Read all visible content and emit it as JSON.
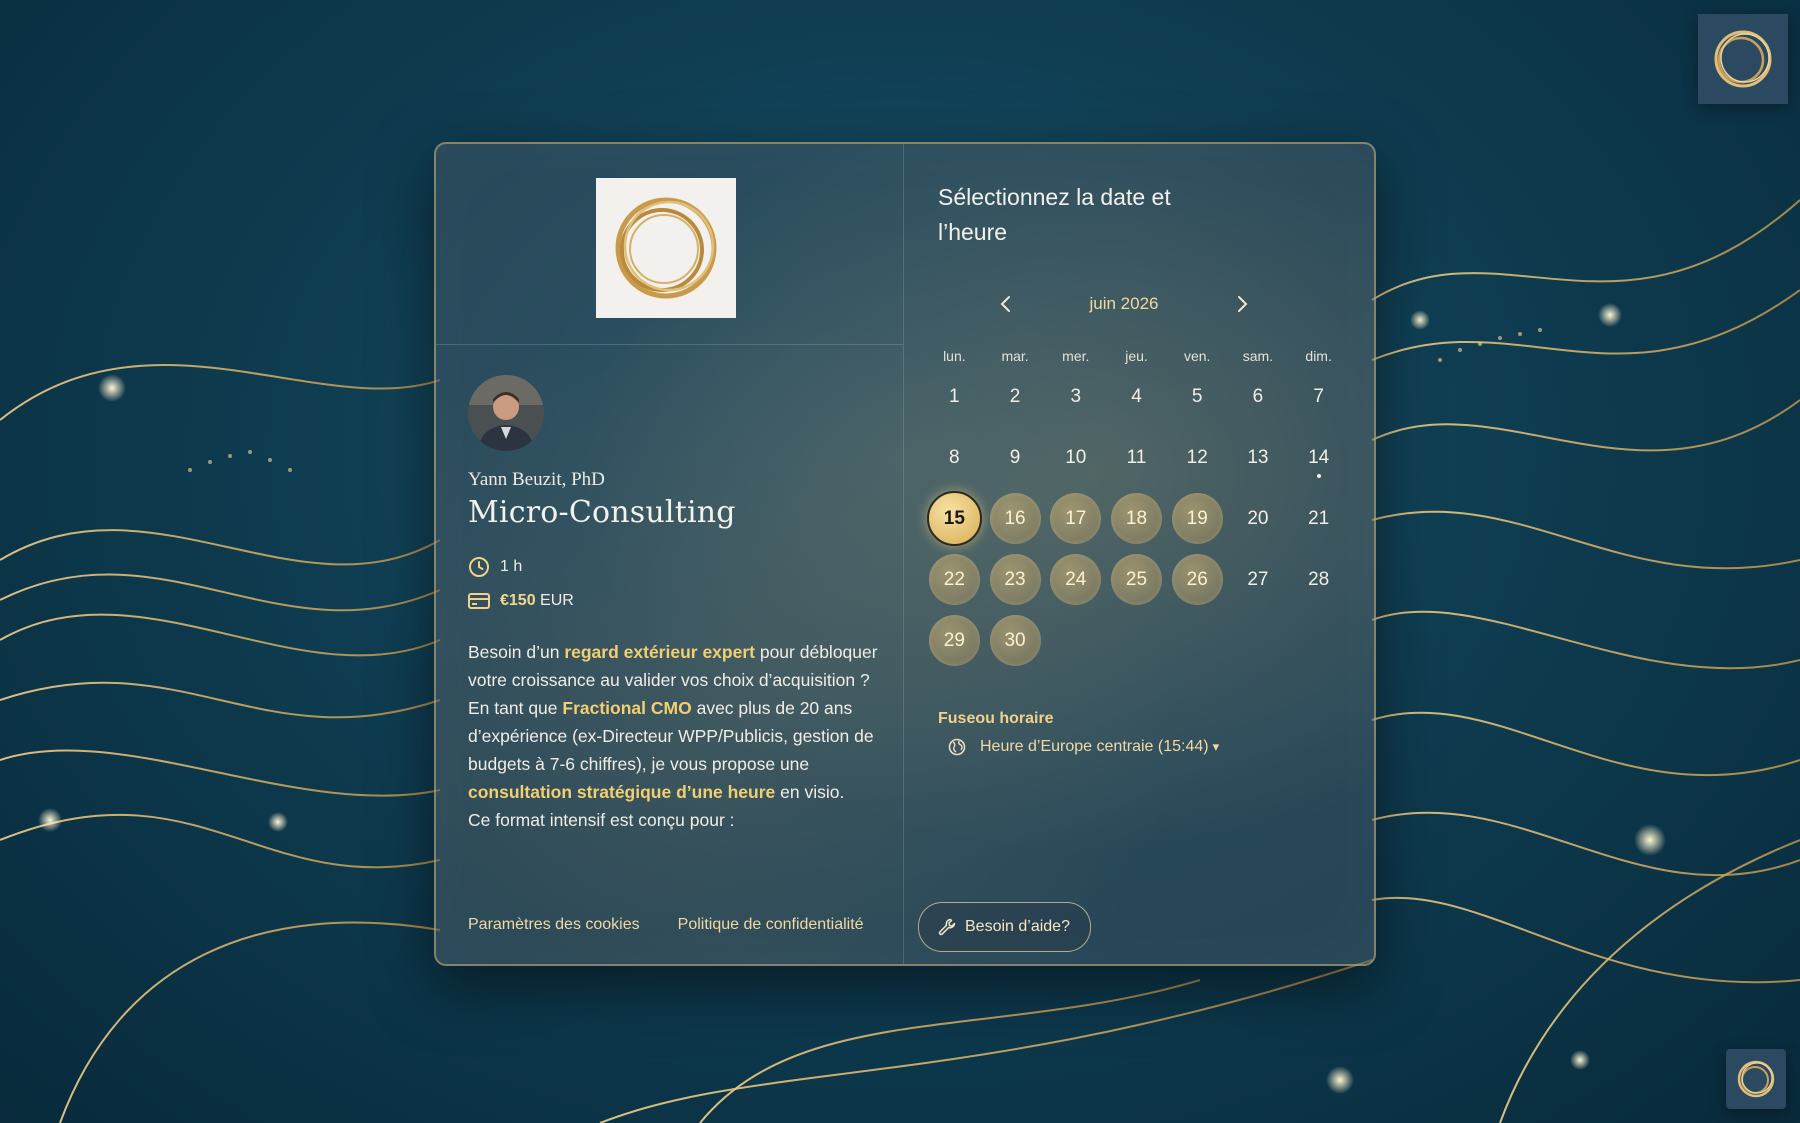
{
  "host": {
    "name": "Yann Beuzit, PhD",
    "avatar_icon": "person-photo"
  },
  "event": {
    "title": "Micro-Consulting",
    "duration": "1 h",
    "price_amount": "€150",
    "price_currency": "EUR"
  },
  "description": {
    "p1": "Besoin d’un ",
    "h1": "regard extérieur expert",
    "p2": " pour débloquer votre croissance au valider vos choix d’acquisition ? En tant que ",
    "h2": "Fractional CMO",
    "p3": " avec plus de 20 ans d’expérience (ex-Directeur WPP/Publicis, gestion de budgets à 7-6 chiffres), je vous propose une ",
    "h3": "consultation stratégique d’une heure",
    "p4": " en visio.",
    "p5": "Ce format intensif est conçu pour :"
  },
  "footer": {
    "cookies": "Paramètres des cookies",
    "privacy": "Politique de confidentialité"
  },
  "calendar": {
    "title": "Sélectionnez la date et l’heure",
    "month": "juin 2026",
    "prev_icon": "chevron-left-icon",
    "next_icon": "chevron-right-icon",
    "weekdays": [
      "lun.",
      "mar.",
      "mer.",
      "jeu.",
      "ven.",
      "sam.",
      "dim."
    ],
    "days": [
      "1",
      "2",
      "3",
      "4",
      "5",
      "6",
      "7",
      "8",
      "9",
      "10",
      "11",
      "12",
      "13",
      "14",
      "15",
      "16",
      "17",
      "18",
      "19",
      "20",
      "21",
      "22",
      "23",
      "24",
      "25",
      "26",
      "27",
      "28",
      "29",
      "30"
    ],
    "available_days": [
      "15",
      "16",
      "17",
      "18",
      "19",
      "22",
      "23",
      "24",
      "25",
      "26",
      "29",
      "30"
    ],
    "selected_day": "15",
    "today_day": "14"
  },
  "timezone": {
    "label": "Fuseou horaire",
    "value": "Heure d’Europe centraie (15:44)",
    "caret": "▾"
  },
  "help": {
    "label": "Besoin d’aide?"
  },
  "colors": {
    "accent_gold": "#f2cf70",
    "background_teal": "#0f3d52"
  }
}
